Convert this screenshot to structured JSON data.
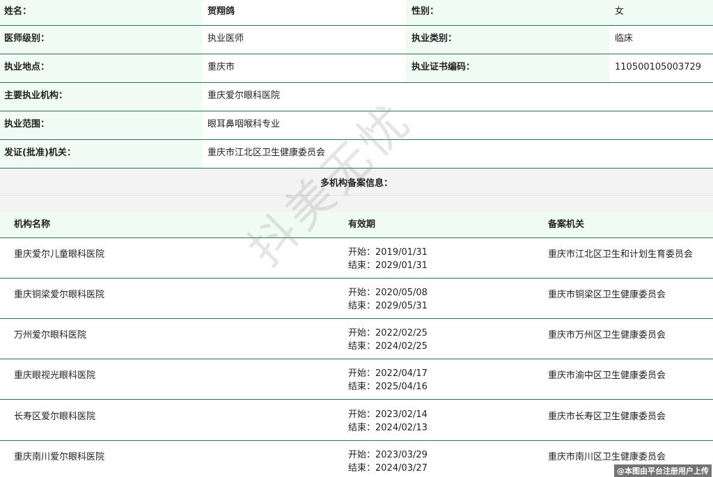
{
  "info": {
    "name_label": "姓名：",
    "name_value": "贺翔鸽",
    "gender_label": "性别：",
    "gender_value": "女",
    "level_label": "医师级别：",
    "level_value": "执业医师",
    "category_label": "执业类别：",
    "category_value": "临床",
    "location_label": "执业地点：",
    "location_value": "重庆市",
    "cert_label": "执业证书编码：",
    "cert_value": "110500105003729",
    "org_label": "主要执业机构：",
    "org_value": "重庆爱尔眼科医院",
    "scope_label": "执业范围：",
    "scope_value": "眼耳鼻咽喉科专业",
    "issuer_label": "发证(批准)机关：",
    "issuer_value": "重庆市江北区卫生健康委员会"
  },
  "multi": {
    "title": "多机构备案信息：",
    "columns": [
      "机构名称",
      "有效期",
      "备案机关"
    ],
    "rows": [
      {
        "name": "重庆爱尔儿童眼科医院",
        "start": "开始：2019/01/31",
        "end": "结束：2029/01/31",
        "authority": "重庆市江北区卫生和计划生育委员会"
      },
      {
        "name": "重庆铜梁爱尔眼科医院",
        "start": "开始：2020/05/08",
        "end": "结束：2029/05/31",
        "authority": "重庆市铜梁区卫生健康委员会"
      },
      {
        "name": "万州爱尔眼科医院",
        "start": "开始：2022/02/25",
        "end": "结束：2024/02/25",
        "authority": "重庆市万州区卫生健康委员会"
      },
      {
        "name": "重庆眼视光眼科医院",
        "start": "开始：2022/04/17",
        "end": "结束：2025/04/16",
        "authority": "重庆市渝中区卫生健康委员会"
      },
      {
        "name": "长寿区爱尔眼科医院",
        "start": "开始：2023/02/14",
        "end": "结束：2024/02/13",
        "authority": "重庆市长寿区卫生健康委员会"
      },
      {
        "name": "重庆南川爱尔眼科医院",
        "start": "开始：2023/03/29",
        "end": "结束：2024/03/27",
        "authority": "重庆市南川区卫生健康委员会"
      }
    ]
  },
  "watermark": "抖美无忧",
  "footer_note": "@本图由平台注册用户上传"
}
